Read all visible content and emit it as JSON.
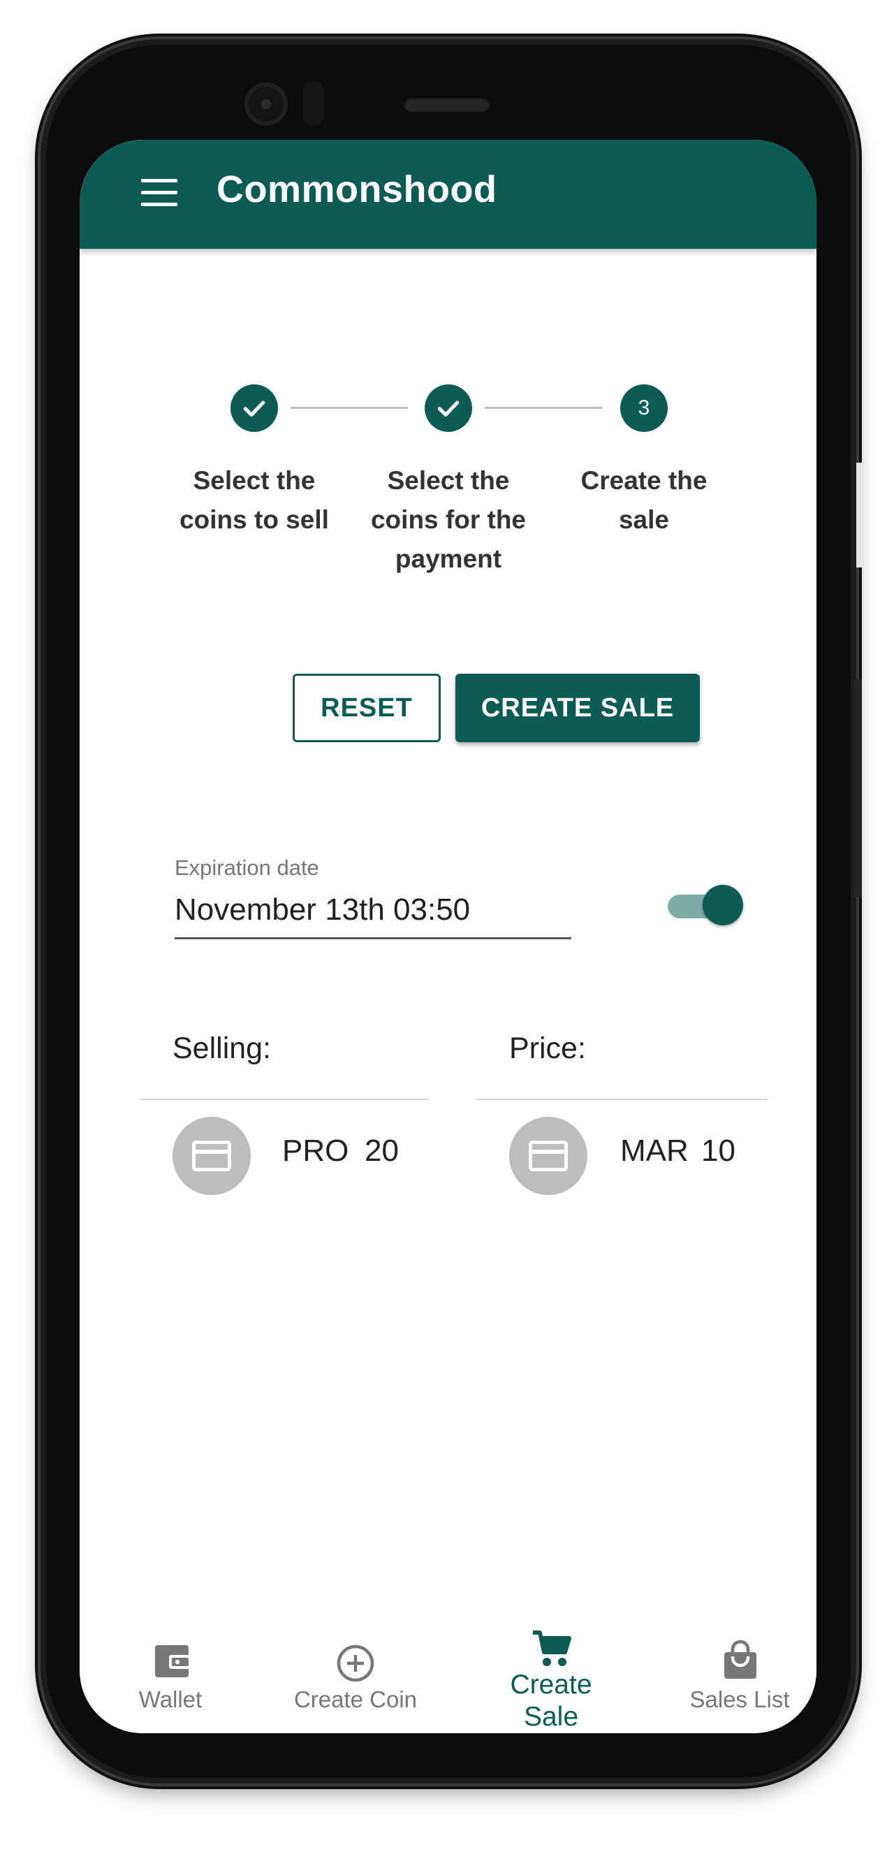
{
  "app": {
    "title": "Commonshood"
  },
  "stepper": {
    "steps": [
      {
        "label_line1": "Select the",
        "label_line2": "coins to sell",
        "label_line3": "",
        "status": "done",
        "number": ""
      },
      {
        "label_line1": "Select the",
        "label_line2": "coins for the",
        "label_line3": "payment",
        "status": "done",
        "number": ""
      },
      {
        "label_line1": "Create the",
        "label_line2": "sale",
        "label_line3": "",
        "status": "active",
        "number": "3"
      }
    ]
  },
  "actions": {
    "reset_label": "RESET",
    "create_label": "CREATE SALE"
  },
  "expiration": {
    "label": "Expiration date",
    "value": "November 13th 03:50",
    "enabled": true
  },
  "selling": {
    "heading": "Selling:",
    "coin_symbol": "PRO",
    "amount": "20"
  },
  "price": {
    "heading": "Price:",
    "coin_symbol": "MAR",
    "amount": "10"
  },
  "bottom_nav": {
    "items": [
      {
        "label": "Wallet",
        "icon": "wallet-icon",
        "active": false
      },
      {
        "label": "Create Coin",
        "icon": "add-circle-icon",
        "active": false
      },
      {
        "label_line1": "Create",
        "label_line2": "Sale",
        "icon": "cart-icon",
        "active": true
      },
      {
        "label": "Sales List",
        "icon": "shopping-bag-icon",
        "active": false
      }
    ]
  },
  "colors": {
    "primary": "#0d5c53",
    "toggle_track": "#7fada6",
    "avatar": "#bdbdbd"
  }
}
